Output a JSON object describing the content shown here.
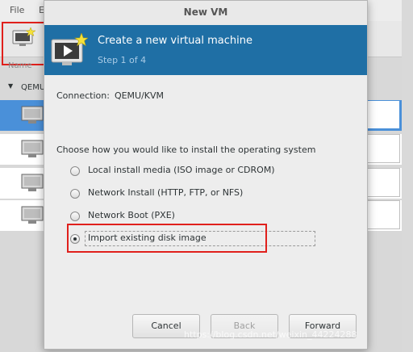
{
  "background": {
    "menu": [
      "File",
      "E"
    ],
    "column_header": "Name",
    "group_label": "QEMU/"
  },
  "dialog": {
    "title": "New VM",
    "banner_title": "Create a new virtual machine",
    "banner_step": "Step 1 of 4",
    "connection_label": "Connection:",
    "connection_value": "QEMU/KVM",
    "question": "Choose how you would like to install the operating system",
    "options": [
      {
        "label": "Local install media (ISO image or CDROM)",
        "selected": false
      },
      {
        "label": "Network Install (HTTP, FTP, or NFS)",
        "selected": false
      },
      {
        "label": "Network Boot (PXE)",
        "selected": false
      },
      {
        "label": "Import existing disk image",
        "selected": true
      }
    ],
    "buttons": {
      "cancel": "Cancel",
      "back": "Back",
      "forward": "Forward"
    }
  },
  "watermark": "https://blog.csdn.net/weixin_44224288",
  "colors": {
    "banner": "#1f6fa5",
    "selection": "#4a90d9",
    "annotation": "#e0201c"
  }
}
